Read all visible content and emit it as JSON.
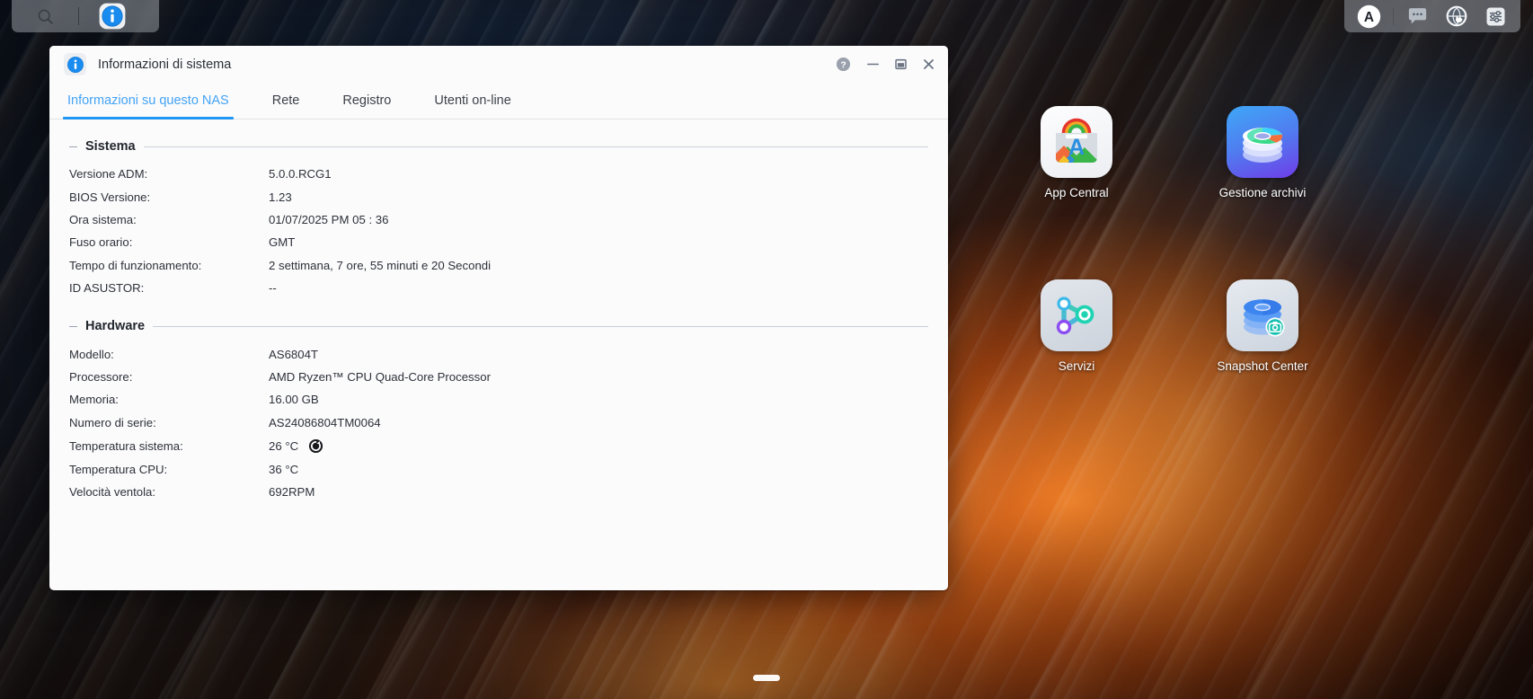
{
  "taskbar": {
    "left_items": [
      {
        "name": "search-icon",
        "label": "Cerca"
      },
      {
        "name": "info-icon",
        "label": "Informazioni di sistema"
      }
    ],
    "right_items": [
      {
        "name": "user-avatar",
        "label": "A"
      },
      {
        "name": "chat-icon",
        "label": "Chat"
      },
      {
        "name": "network-globe-icon",
        "label": "Rete"
      },
      {
        "name": "control-panel-icon",
        "label": "Pannello di controllo"
      }
    ]
  },
  "desktop": {
    "icons": [
      {
        "name": "app-central",
        "label": "App Central"
      },
      {
        "name": "gestione-archivi",
        "label": "Gestione archivi"
      },
      {
        "name": "servizi",
        "label": "Servizi"
      },
      {
        "name": "snapshot-center",
        "label": "Snapshot Center"
      }
    ]
  },
  "window": {
    "title": "Informazioni di sistema",
    "controls": {
      "help": "?",
      "minimize": "—",
      "maximize": "□",
      "close": "✕"
    },
    "tabs": [
      {
        "label": "Informazioni su questo NAS",
        "active": true
      },
      {
        "label": "Rete",
        "active": false
      },
      {
        "label": "Registro",
        "active": false
      },
      {
        "label": "Utenti on-line",
        "active": false
      }
    ],
    "sections": [
      {
        "title": "Sistema",
        "rows": [
          {
            "key": "Versione ADM:",
            "value": "5.0.0.RCG1"
          },
          {
            "key": "BIOS Versione:",
            "value": "1.23"
          },
          {
            "key": "Ora sistema:",
            "value": "01/07/2025  PM 05 : 36"
          },
          {
            "key": "Fuso orario:",
            "value": "GMT"
          },
          {
            "key": "Tempo di funzionamento:",
            "value": "2 settimana, 7 ore, 55 minuti e 20 Secondi"
          },
          {
            "key": "ID ASUSTOR:",
            "value": "--"
          }
        ]
      },
      {
        "title": "Hardware",
        "rows": [
          {
            "key": "Modello:",
            "value": "AS6804T"
          },
          {
            "key": "Processore:",
            "value": "AMD Ryzen™ CPU Quad-Core Processor"
          },
          {
            "key": "Memoria:",
            "value": "16.00 GB"
          },
          {
            "key": "Numero di serie:",
            "value": "AS24086804TM0064"
          },
          {
            "key": "Temperatura sistema:",
            "value": "26 °C",
            "refresh": true
          },
          {
            "key": "Temperatura CPU:",
            "value": "36 °C"
          },
          {
            "key": "Velocità ventola:",
            "value": "692RPM"
          }
        ]
      }
    ]
  },
  "colors": {
    "accent": "#2196f3",
    "tab_active_text": "#43a3f5",
    "text": "#2d3139",
    "window_bg": "#fbfbfc"
  }
}
